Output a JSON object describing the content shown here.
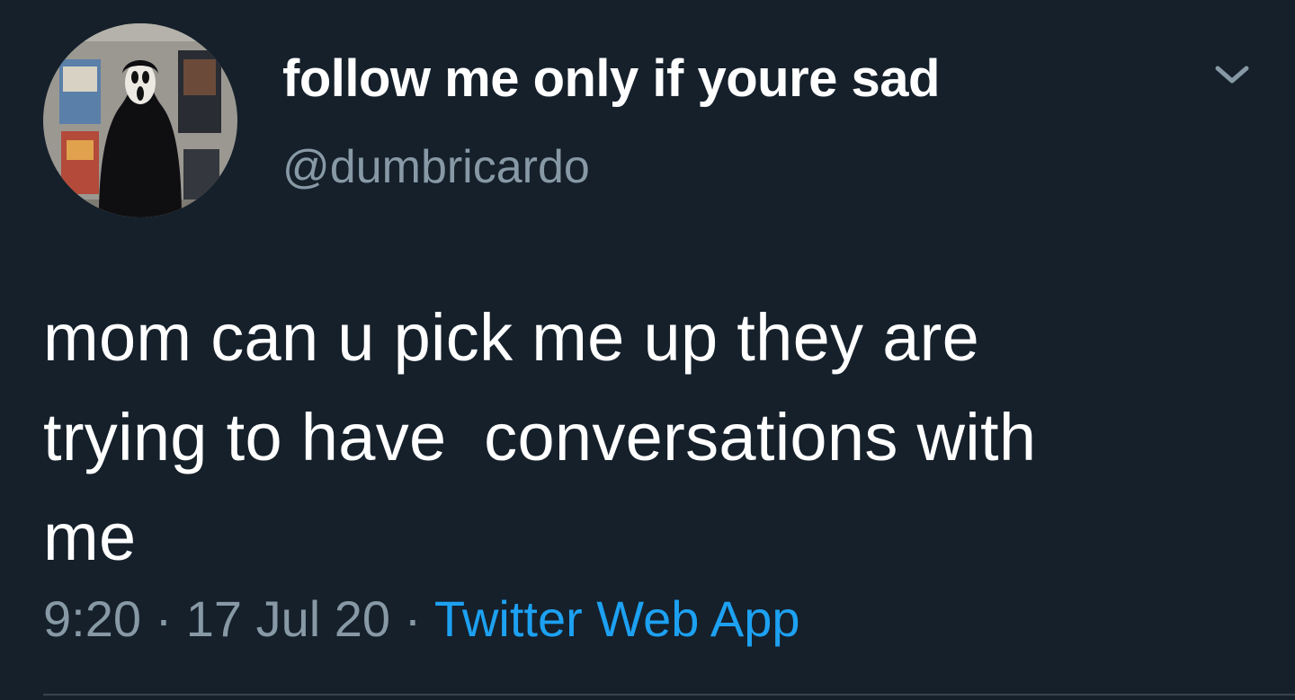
{
  "tweet": {
    "display_name": "follow me only if youre sad",
    "handle": "@dumbricardo",
    "text": "mom can u pick me up they are\ntrying to have  conversations with\nme",
    "time": "9:20",
    "separator": "·",
    "date": "17 Jul 20",
    "source": "Twitter Web App"
  },
  "icons": {
    "avatar": "ghostface-profile-photo",
    "menu": "chevron-down-icon"
  },
  "colors": {
    "background": "#15202b",
    "text_primary": "#ffffff",
    "text_secondary": "#8899a6",
    "link": "#1da1f2",
    "divider": "#38444d"
  }
}
